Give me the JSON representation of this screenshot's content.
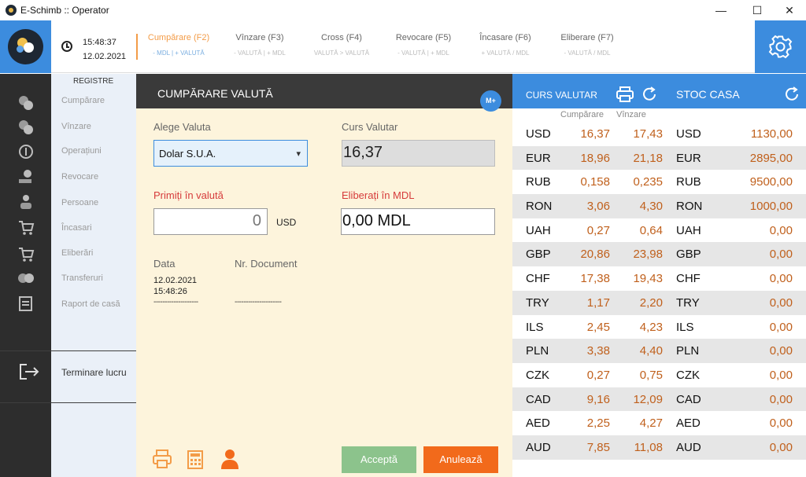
{
  "window": {
    "title": "E-Schimb :: Operator",
    "minimize": "—",
    "maximize": "☐",
    "close": "✕"
  },
  "header": {
    "time": "15:48:37",
    "date": "12.02.2021",
    "tabs": [
      {
        "label": "Cumpărare (F2)",
        "sub": "- MDL | + VALUTĂ",
        "active": true
      },
      {
        "label": "Vînzare (F3)",
        "sub": "- VALUTĂ | + MDL",
        "active": false
      },
      {
        "label": "Cross (F4)",
        "sub": "VALUTĂ > VALUTĂ",
        "active": false
      },
      {
        "label": "Revocare (F5)",
        "sub": "- VALUTĂ | + MDL",
        "active": false
      },
      {
        "label": "Încasare (F6)",
        "sub": "+ VALUTĂ / MDL",
        "active": false
      },
      {
        "label": "Eliberare (F7)",
        "sub": "- VALUTĂ / MDL",
        "active": false
      }
    ]
  },
  "sidebar": {
    "section": "REGISTRE",
    "items": [
      "Cumpărare",
      "Vînzare",
      "Operațiuni",
      "Revocare",
      "Persoane",
      "Încasari",
      "Eliberări",
      "Transferuri",
      "Raport de casă"
    ],
    "logout": "Terminare lucru"
  },
  "form": {
    "title": "CUMPĂRARE VALUTĂ",
    "mplus": "M+",
    "currency_label": "Alege Valuta",
    "currency_value": "Dolar S.U.A.",
    "rate_label": "Curs Valutar",
    "rate_value": "16,37",
    "receive_label": "Primiți în valută",
    "receive_value": "0",
    "receive_currency": "USD",
    "pay_label": "Eliberați în MDL",
    "pay_value": "0,00 MDL",
    "data_label": "Data",
    "doc_label": "Nr. Document",
    "data_date": "12.02.2021",
    "data_time": "15:48:26",
    "data_dashes": "--------------------",
    "doc_dashes": "---------------------",
    "accept": "Acceptă",
    "cancel": "Anulează"
  },
  "rates": {
    "title": "CURS VALUTAR",
    "buy_header": "Cumpărare",
    "sell_header": "Vînzare",
    "stock_title": "STOC CASA",
    "rows": [
      {
        "code": "USD",
        "buy": "16,37",
        "sell": "17,43",
        "stock_code": "USD",
        "stock": "1130,00"
      },
      {
        "code": "EUR",
        "buy": "18,96",
        "sell": "21,18",
        "stock_code": "EUR",
        "stock": "2895,00"
      },
      {
        "code": "RUB",
        "buy": "0,158",
        "sell": "0,235",
        "stock_code": "RUB",
        "stock": "9500,00"
      },
      {
        "code": "RON",
        "buy": "3,06",
        "sell": "4,30",
        "stock_code": "RON",
        "stock": "1000,00"
      },
      {
        "code": "UAH",
        "buy": "0,27",
        "sell": "0,64",
        "stock_code": "UAH",
        "stock": "0,00"
      },
      {
        "code": "GBP",
        "buy": "20,86",
        "sell": "23,98",
        "stock_code": "GBP",
        "stock": "0,00"
      },
      {
        "code": "CHF",
        "buy": "17,38",
        "sell": "19,43",
        "stock_code": "CHF",
        "stock": "0,00"
      },
      {
        "code": "TRY",
        "buy": "1,17",
        "sell": "2,20",
        "stock_code": "TRY",
        "stock": "0,00"
      },
      {
        "code": "ILS",
        "buy": "2,45",
        "sell": "4,23",
        "stock_code": "ILS",
        "stock": "0,00"
      },
      {
        "code": "PLN",
        "buy": "3,38",
        "sell": "4,40",
        "stock_code": "PLN",
        "stock": "0,00"
      },
      {
        "code": "CZK",
        "buy": "0,27",
        "sell": "0,75",
        "stock_code": "CZK",
        "stock": "0,00"
      },
      {
        "code": "CAD",
        "buy": "9,16",
        "sell": "12,09",
        "stock_code": "CAD",
        "stock": "0,00"
      },
      {
        "code": "AED",
        "buy": "2,25",
        "sell": "4,27",
        "stock_code": "AED",
        "stock": "0,00"
      },
      {
        "code": "AUD",
        "buy": "7,85",
        "sell": "11,08",
        "stock_code": "AUD",
        "stock": "0,00"
      }
    ]
  },
  "colors": {
    "accent_blue": "#3c8cde",
    "accent_orange": "#f39c48",
    "value_orange": "#c0601c",
    "form_bg": "#fdf4dc",
    "accept_green": "#8cc38c",
    "cancel_orange": "#f26a1b"
  }
}
